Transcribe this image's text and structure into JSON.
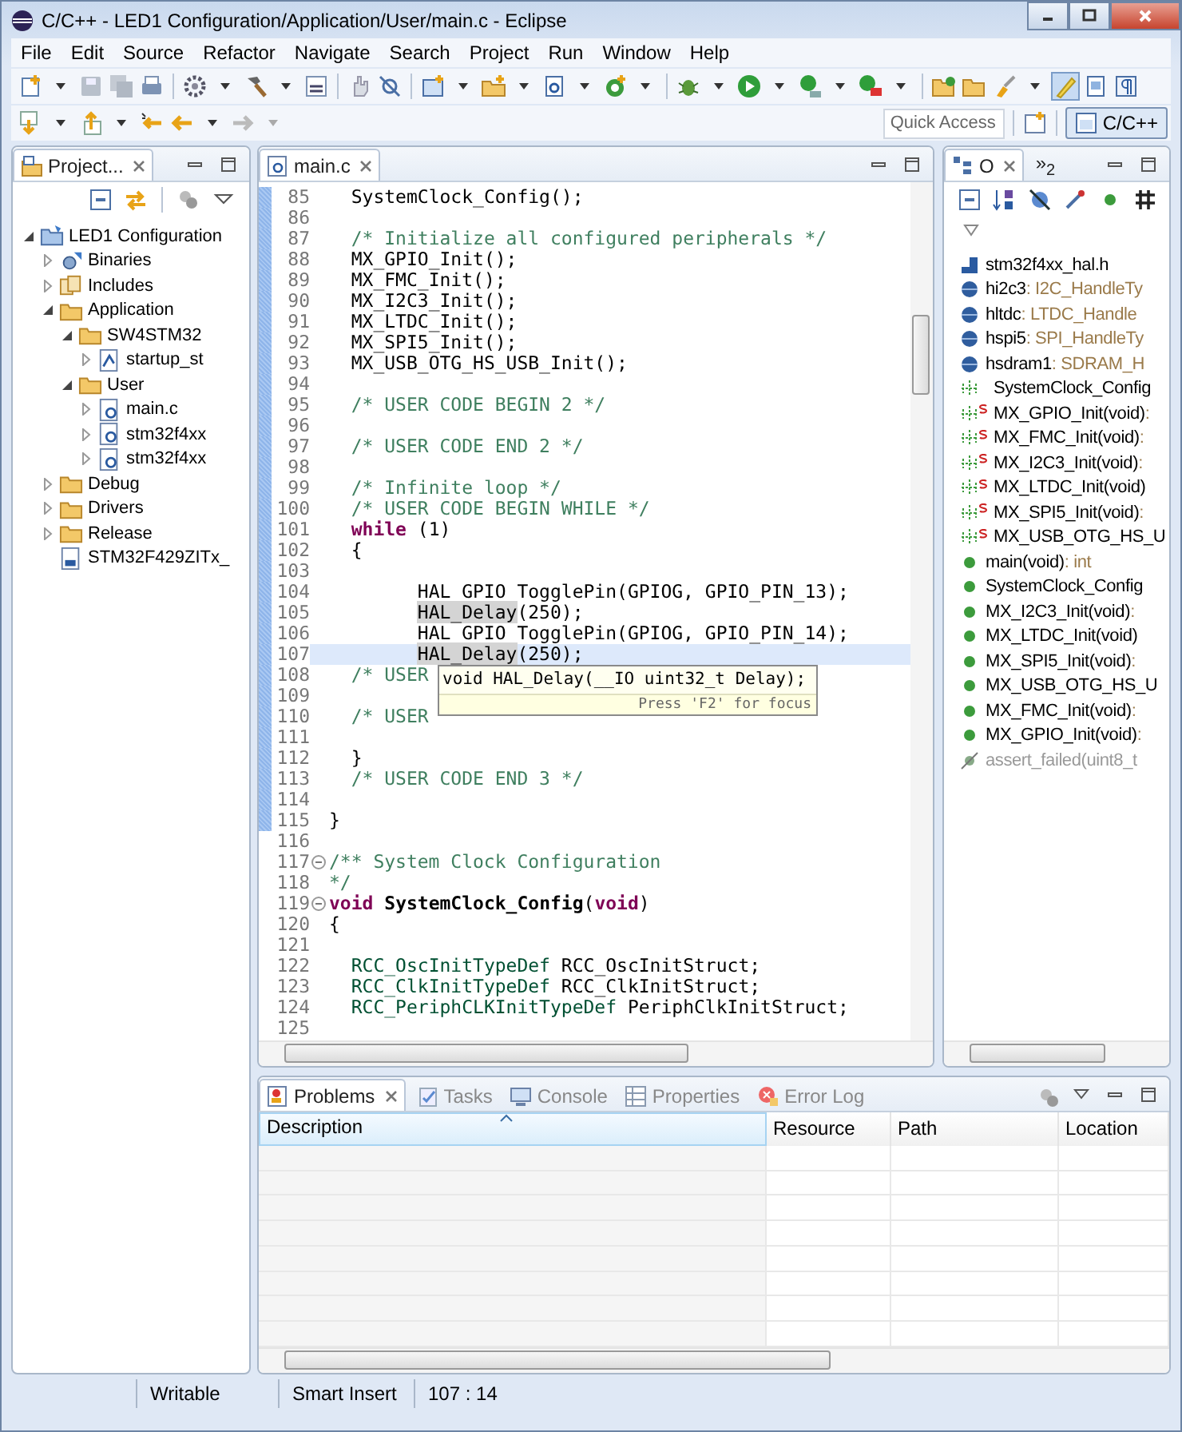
{
  "window": {
    "title": "C/C++ - LED1 Configuration/Application/User/main.c - Eclipse"
  },
  "menu": [
    "File",
    "Edit",
    "Source",
    "Refactor",
    "Navigate",
    "Search",
    "Project",
    "Run",
    "Window",
    "Help"
  ],
  "quick_access": {
    "placeholder": "Quick Access"
  },
  "perspectives": [
    {
      "label": "C/C++",
      "selected": true
    }
  ],
  "project_explorer": {
    "tab": {
      "label": "Project...",
      "selected": true
    },
    "tree": [
      {
        "label": "LED1 Configuration",
        "kind": "project",
        "expanded": true,
        "children": [
          {
            "label": "Binaries",
            "kind": "binaries",
            "expanded": false
          },
          {
            "label": "Includes",
            "kind": "includes",
            "expanded": false
          },
          {
            "label": "Application",
            "kind": "folder",
            "expanded": true,
            "children": [
              {
                "label": "SW4STM32",
                "kind": "folder",
                "expanded": true,
                "children": [
                  {
                    "label": "startup_st",
                    "kind": "asm",
                    "expanded": false
                  }
                ]
              },
              {
                "label": "User",
                "kind": "folder",
                "expanded": true,
                "children": [
                  {
                    "label": "main.c",
                    "kind": "c",
                    "expanded": false
                  },
                  {
                    "label": "stm32f4xx",
                    "kind": "c",
                    "expanded": false
                  },
                  {
                    "label": "stm32f4xx",
                    "kind": "c",
                    "expanded": false
                  }
                ]
              }
            ]
          },
          {
            "label": "Debug",
            "kind": "folder",
            "expanded": false
          },
          {
            "label": "Drivers",
            "kind": "folder",
            "expanded": false
          },
          {
            "label": "Release",
            "kind": "folder",
            "expanded": false
          },
          {
            "label": "STM32F429ZITx_",
            "kind": "ld"
          }
        ]
      }
    ]
  },
  "editor": {
    "tab": {
      "label": "main.c",
      "selected": true
    },
    "lines": [
      {
        "n": "85",
        "modified": true,
        "segs": [
          {
            "text": "  SystemClock_Config();",
            "kind": "plain"
          }
        ]
      },
      {
        "n": "86",
        "modified": true
      },
      {
        "n": "87",
        "modified": true,
        "segs": [
          {
            "text": "  /* Initialize all configured peripherals */",
            "kind": "comment"
          }
        ]
      },
      {
        "n": "88",
        "modified": true,
        "segs": [
          {
            "text": "  MX_GPIO_Init();",
            "kind": "plain"
          }
        ]
      },
      {
        "n": "89",
        "modified": true,
        "segs": [
          {
            "text": "  MX_FMC_Init();",
            "kind": "plain"
          }
        ]
      },
      {
        "n": "90",
        "modified": true,
        "segs": [
          {
            "text": "  MX_I2C3_Init();",
            "kind": "plain"
          }
        ]
      },
      {
        "n": "91",
        "modified": true,
        "segs": [
          {
            "text": "  MX_LTDC_Init();",
            "kind": "plain"
          }
        ]
      },
      {
        "n": "92",
        "modified": true,
        "segs": [
          {
            "text": "  MX_SPI5_Init();",
            "kind": "plain"
          }
        ]
      },
      {
        "n": "93",
        "modified": true,
        "segs": [
          {
            "text": "  MX_USB_OTG_HS_USB_Init();",
            "kind": "plain"
          }
        ]
      },
      {
        "n": "94",
        "modified": true
      },
      {
        "n": "95",
        "modified": true,
        "segs": [
          {
            "text": "  /* USER CODE BEGIN 2 */",
            "kind": "comment"
          }
        ]
      },
      {
        "n": "96",
        "modified": true
      },
      {
        "n": "97",
        "modified": true,
        "segs": [
          {
            "text": "  /* USER CODE END 2 */",
            "kind": "comment"
          }
        ]
      },
      {
        "n": "98",
        "modified": true
      },
      {
        "n": "99",
        "modified": true,
        "segs": [
          {
            "text": "  /* Infinite loop */",
            "kind": "comment"
          }
        ]
      },
      {
        "n": "100",
        "modified": true,
        "segs": [
          {
            "text": "  /* USER CODE BEGIN WHILE */",
            "kind": "comment"
          }
        ]
      },
      {
        "n": "101",
        "modified": true,
        "segs": [
          {
            "text": "  while",
            "kind": "keyword"
          },
          {
            "text": " (1)",
            "kind": "plain"
          }
        ]
      },
      {
        "n": "102",
        "modified": true,
        "segs": [
          {
            "text": "  {",
            "kind": "plain"
          }
        ]
      },
      {
        "n": "103",
        "modified": true
      },
      {
        "n": "104",
        "modified": true,
        "segs": [
          {
            "text": "        HAL_GPIO_TogglePin(GPIOG, GPIO_PIN_13);",
            "kind": "plain"
          }
        ]
      },
      {
        "n": "105",
        "modified": true,
        "segs": [
          {
            "text": "        HAL_Delay",
            "kind": "occurrence"
          },
          {
            "text": "(250);",
            "kind": "plain"
          }
        ]
      },
      {
        "n": "106",
        "modified": true,
        "segs": [
          {
            "text": "        HAL_GPIO_TogglePin(GPIOG, GPIO_PIN_14);",
            "kind": "plain"
          }
        ]
      },
      {
        "n": "107",
        "modified": true,
        "current": true,
        "segs": [
          {
            "text": "        HAL_Delay",
            "kind": "occurrence"
          },
          {
            "text": "(250);",
            "kind": "plain"
          }
        ]
      },
      {
        "n": "108",
        "modified": true,
        "segs": [
          {
            "text": "  /* USER",
            "kind": "comment"
          }
        ]
      },
      {
        "n": "109",
        "modified": true
      },
      {
        "n": "110",
        "modified": true,
        "segs": [
          {
            "text": "  /* USER",
            "kind": "comment"
          }
        ]
      },
      {
        "n": "111",
        "modified": true
      },
      {
        "n": "112",
        "modified": true,
        "segs": [
          {
            "text": "  }",
            "kind": "plain"
          }
        ]
      },
      {
        "n": "113",
        "modified": true,
        "segs": [
          {
            "text": "  /* USER CODE END 3 */",
            "kind": "comment"
          }
        ]
      },
      {
        "n": "114",
        "modified": true
      },
      {
        "n": "115",
        "modified": true,
        "segs": [
          {
            "text": "}",
            "kind": "plain"
          }
        ]
      },
      {
        "n": "116",
        "modified": false
      },
      {
        "n": "117",
        "modified": false,
        "fold": true,
        "segs": [
          {
            "text": "/** System Clock Configuration",
            "kind": "comment"
          }
        ]
      },
      {
        "n": "118",
        "modified": false,
        "segs": [
          {
            "text": "*/",
            "kind": "comment"
          }
        ]
      },
      {
        "n": "119",
        "modified": false,
        "fold": true,
        "segs": [
          {
            "text": "void",
            "kind": "keyword"
          },
          {
            "text": " SystemClock_Config",
            "kind": "declaration"
          },
          {
            "text": "(",
            "kind": "plain"
          },
          {
            "text": "void",
            "kind": "keyword"
          },
          {
            "text": ")",
            "kind": "plain"
          }
        ]
      },
      {
        "n": "120",
        "modified": false,
        "segs": [
          {
            "text": "{",
            "kind": "plain"
          }
        ]
      },
      {
        "n": "121",
        "modified": false
      },
      {
        "n": "122",
        "modified": false,
        "segs": [
          {
            "text": "  RCC_OscInitTypeDef",
            "kind": "type"
          },
          {
            "text": " RCC_OscInitStruct;",
            "kind": "plain"
          }
        ]
      },
      {
        "n": "123",
        "modified": false,
        "segs": [
          {
            "text": "  RCC_ClkInitTypeDef",
            "kind": "type"
          },
          {
            "text": " RCC_ClkInitStruct;",
            "kind": "plain"
          }
        ]
      },
      {
        "n": "124",
        "modified": false,
        "segs": [
          {
            "text": "  RCC_PeriphCLKInitTypeDef",
            "kind": "type"
          },
          {
            "text": " PeriphClkInitStruct;",
            "kind": "plain"
          }
        ]
      },
      {
        "n": "125",
        "modified": false
      }
    ],
    "tooltip": {
      "signature": "void HAL_Delay(__IO uint32_t Delay);",
      "hint": "Press 'F2' for focus"
    }
  },
  "outline": {
    "tabs": [
      {
        "label": "O",
        "selected": true
      },
      {
        "label": "»$_{2}$",
        "selected": false
      }
    ],
    "items": [
      {
        "label": "stm32f4xx_hal.h",
        "kind": "include"
      },
      {
        "label": "hi2c3",
        "detail": ": I2C_HandleTy",
        "kind": "field"
      },
      {
        "label": "hltdc",
        "detail": ": LTDC_Handle",
        "kind": "field"
      },
      {
        "label": "hspi5",
        "detail": ": SPI_HandleTy",
        "kind": "field"
      },
      {
        "label": "hsdram1",
        "detail": ": SDRAM_H",
        "kind": "field"
      },
      {
        "label": "SystemClock_Config",
        "kind": "prototype",
        "static": false
      },
      {
        "label": "MX_GPIO_Init(void)",
        "detail": ":",
        "kind": "prototype",
        "static": true
      },
      {
        "label": "MX_FMC_Init(void)",
        "detail": ":",
        "kind": "prototype",
        "static": true
      },
      {
        "label": "MX_I2C3_Init(void)",
        "detail": ":",
        "kind": "prototype",
        "static": true
      },
      {
        "label": "MX_LTDC_Init(void)",
        "kind": "prototype",
        "static": true
      },
      {
        "label": "MX_SPI5_Init(void)",
        "detail": ":",
        "kind": "prototype",
        "static": true
      },
      {
        "label": "MX_USB_OTG_HS_U",
        "kind": "prototype",
        "static": true
      },
      {
        "label": "main(void)",
        "detail": ": int",
        "kind": "function"
      },
      {
        "label": "SystemClock_Config",
        "kind": "function"
      },
      {
        "label": "MX_I2C3_Init(void)",
        "detail": ":",
        "kind": "function"
      },
      {
        "label": "MX_LTDC_Init(void)",
        "kind": "function"
      },
      {
        "label": "MX_SPI5_Init(void)",
        "detail": ":",
        "kind": "function"
      },
      {
        "label": "MX_USB_OTG_HS_U",
        "kind": "function"
      },
      {
        "label": "MX_FMC_Init(void)",
        "detail": ":",
        "kind": "function"
      },
      {
        "label": "MX_GPIO_Init(void)",
        "detail": ":",
        "kind": "function"
      },
      {
        "label": "assert_failed(uint8_t",
        "kind": "inactive"
      }
    ]
  },
  "bottom_panel": {
    "tabs": [
      {
        "label": "Problems",
        "selected": true
      },
      {
        "label": "Tasks",
        "selected": false
      },
      {
        "label": "Console",
        "selected": false
      },
      {
        "label": "Properties",
        "selected": false
      },
      {
        "label": "Error Log",
        "selected": false
      }
    ],
    "table": {
      "columns": [
        "Description",
        "Resource",
        "Path",
        "Location"
      ]
    }
  },
  "status_bar": [
    "Writable",
    "Smart Insert",
    "107 : 14"
  ]
}
